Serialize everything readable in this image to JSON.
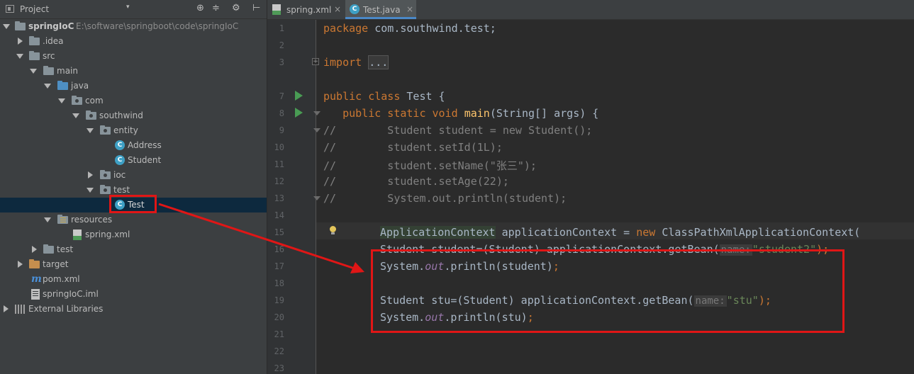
{
  "sidebar": {
    "title": "Project",
    "dropdown": "▾",
    "header_icons": [
      "⊕",
      "≑",
      "⚙",
      "⊢"
    ],
    "tree": [
      {
        "label": "springIoC",
        "path": "E:\\software\\springboot\\code\\springIoC",
        "icon": "folder-icon"
      },
      {
        "label": ".idea",
        "icon": "folder-icon"
      },
      {
        "label": "src",
        "icon": "folder-icon"
      },
      {
        "label": "main",
        "icon": "folder-icon"
      },
      {
        "label": "java",
        "icon": "folder-icon"
      },
      {
        "label": "com",
        "icon": "package-icon"
      },
      {
        "label": "southwind",
        "icon": "package-icon"
      },
      {
        "label": "entity",
        "icon": "package-icon"
      },
      {
        "label": "Address",
        "icon": "class-icon"
      },
      {
        "label": "Student",
        "icon": "class-icon"
      },
      {
        "label": "ioc",
        "icon": "package-icon"
      },
      {
        "label": "test",
        "icon": "package-icon"
      },
      {
        "label": "Test",
        "icon": "class-icon"
      },
      {
        "label": "resources",
        "icon": "resources-folder-icon"
      },
      {
        "label": "spring.xml",
        "icon": "xml-file-icon"
      },
      {
        "label": "test",
        "icon": "folder-icon"
      },
      {
        "label": "target",
        "icon": "folder-icon"
      },
      {
        "label": "pom.xml",
        "icon": "maven-icon"
      },
      {
        "label": "springIoC.iml",
        "icon": "iml-file-icon"
      },
      {
        "label": "External Libraries",
        "icon": "library-icon"
      }
    ],
    "class_icon_letter": "C",
    "maven_icon_letter": "m"
  },
  "tabs": [
    {
      "label": "spring.xml",
      "active": false
    },
    {
      "label": "Test.java",
      "active": true
    }
  ],
  "tab_close": "×",
  "editor": {
    "line_numbers": [
      "1",
      "2",
      "3",
      "7",
      "8",
      "9",
      "10",
      "11",
      "12",
      "13",
      "14",
      "15",
      "16",
      "17",
      "18",
      "19",
      "20",
      "21",
      "22",
      "23"
    ],
    "code": {
      "l1_kw": "package",
      "l1_rest": " com.southwind.test;",
      "l3_kw": "import",
      "l3_fold": "...",
      "l7_kw": "public class",
      "l7_rest": " Test {",
      "l8_kw": "public static void",
      "l8_fn": "main",
      "l8_rest": "(String[] args) {",
      "l9": "//        Student student = new Student();",
      "l10": "//        student.setId(1L);",
      "l11": "//        student.setName(\"张三\");",
      "l12": "//        student.setAge(22);",
      "l13": "//        System.out.println(student);",
      "l15_a": "ApplicationContext",
      "l15_b": " applicationContext = ",
      "l15_kw": "new",
      "l15_c": " ClassPathXmlApplicationContext(",
      "l16_a": "Student student=(Student) applicationContext.getBean(",
      "l16_hint": "name:",
      "l16_str": "\"student2\"",
      "l16_end": ");",
      "l17_a": "System.",
      "l17_out": "out",
      "l17_b": ".println(student)",
      "l17_end": ";",
      "l19_a": "Student stu=(Student) applicationContext.getBean(",
      "l19_hint": "name:",
      "l19_str": "\"stu\"",
      "l19_end": ");",
      "l20_a": "System.",
      "l20_out": "out",
      "l20_b": ".println(stu)",
      "l20_end": ";"
    }
  },
  "colors": {
    "keyword": "#cc7832",
    "comment": "#808080",
    "string": "#6a8759",
    "annotation_red": "#e01616"
  }
}
